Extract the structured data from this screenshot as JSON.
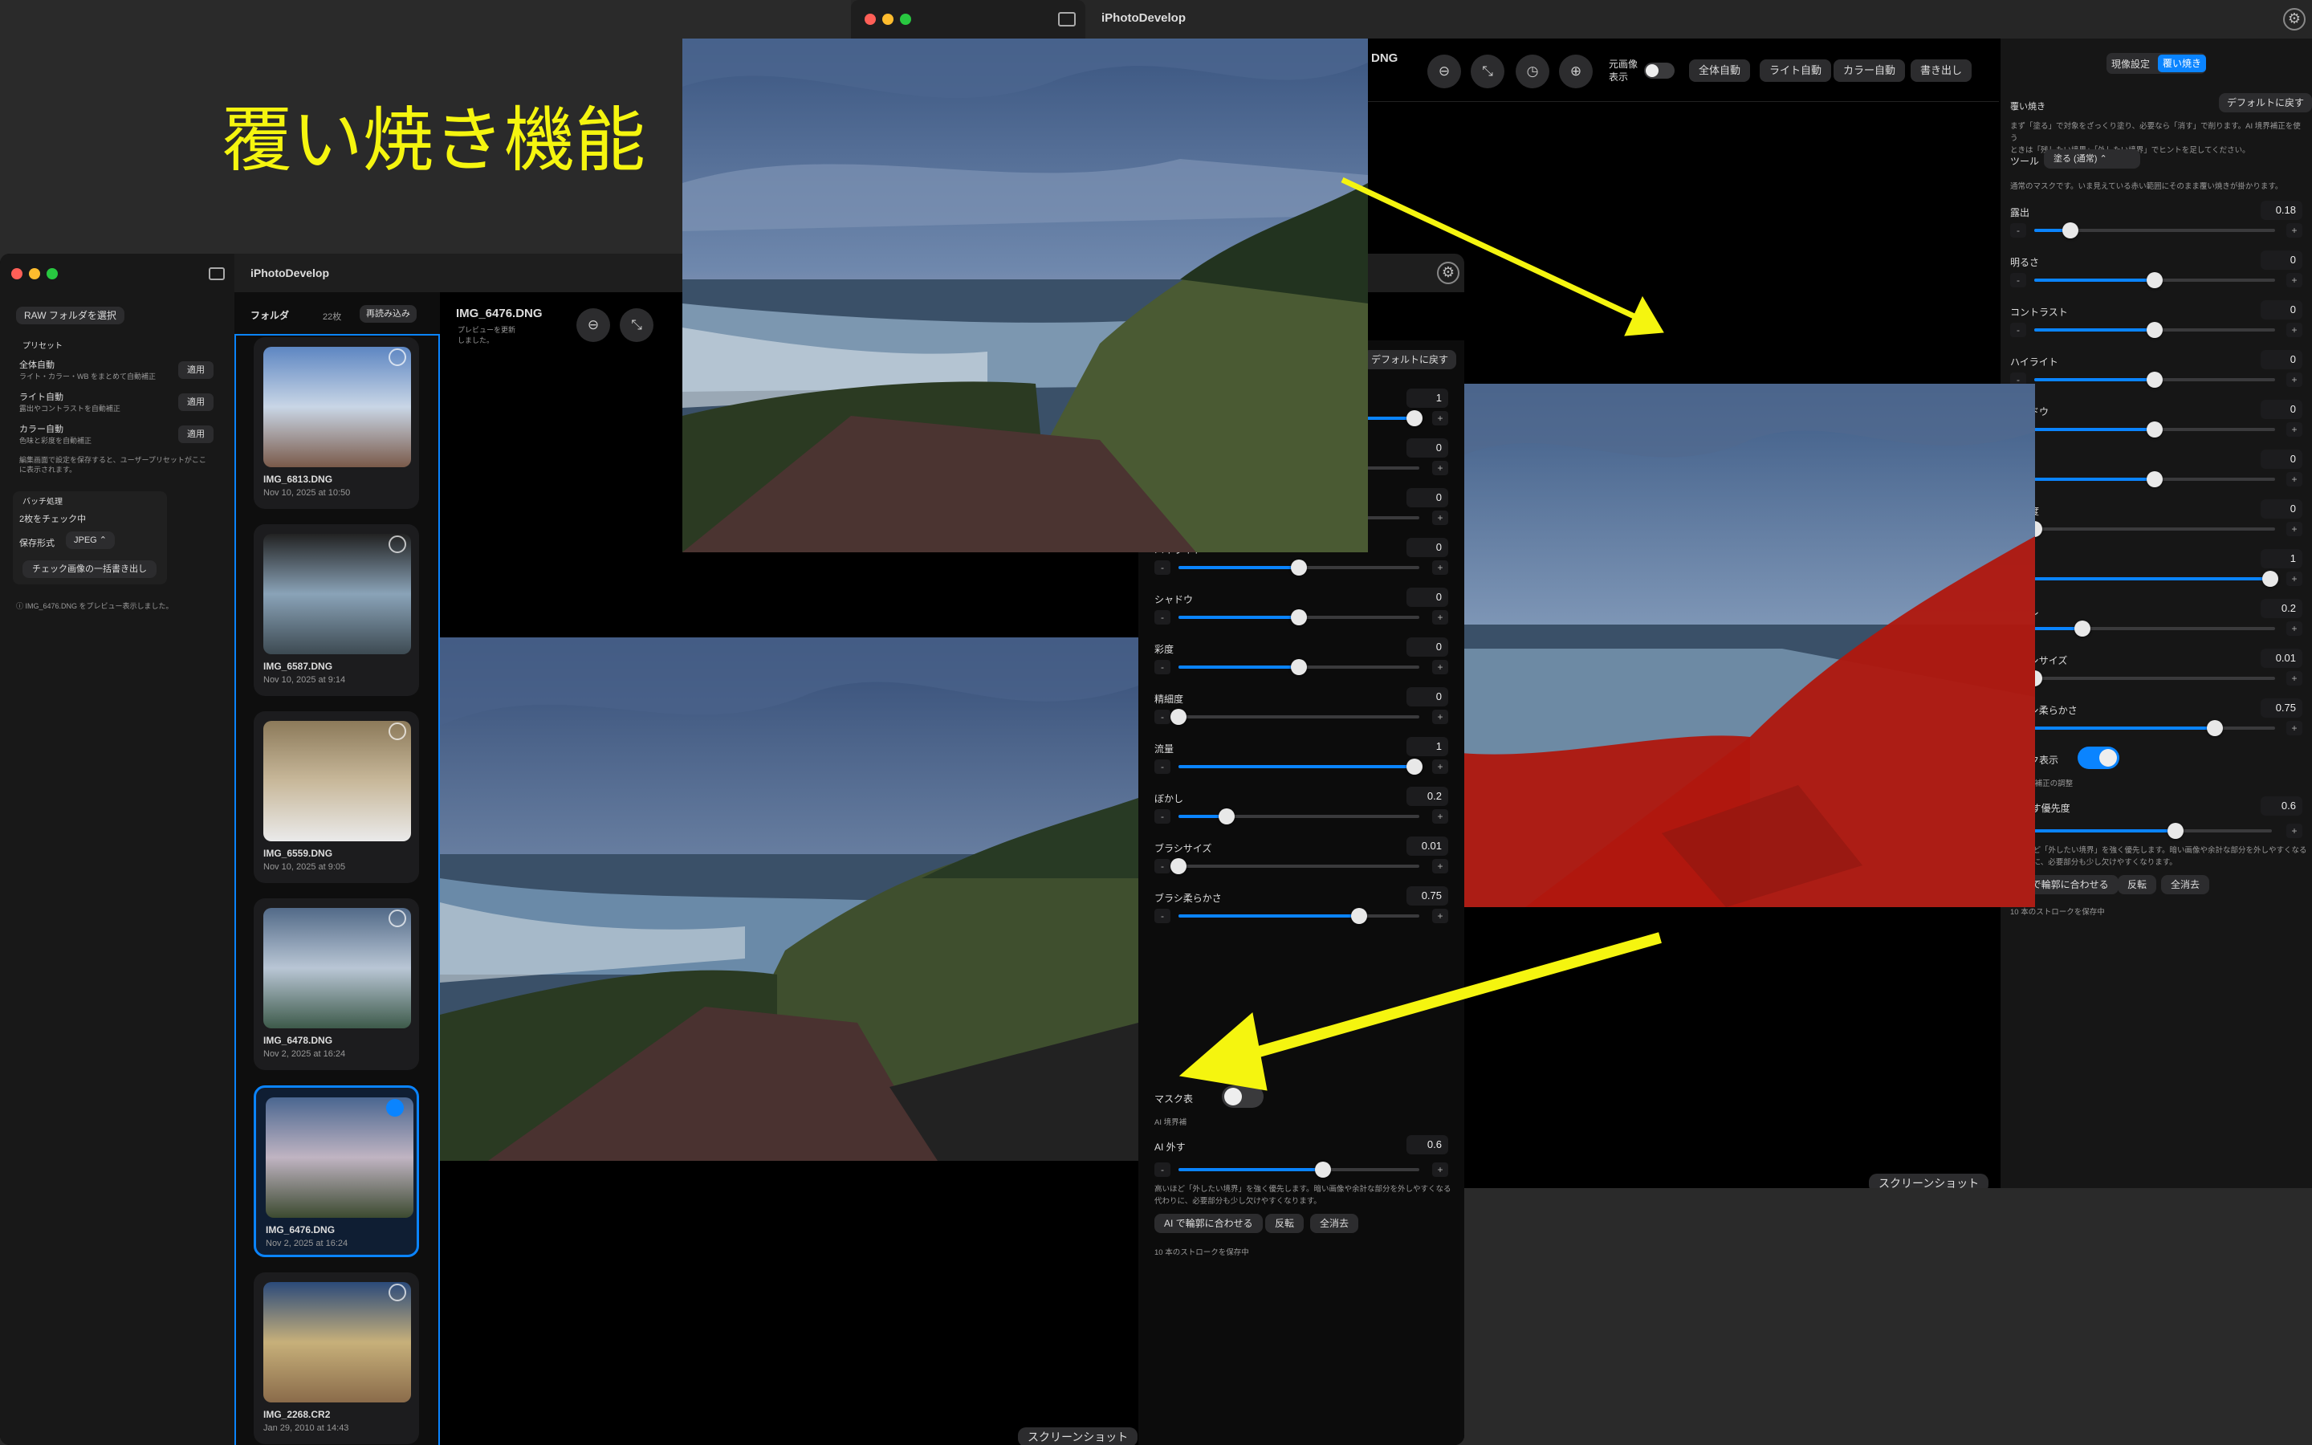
{
  "annotation_title": "覆い焼き機能",
  "app": {
    "name": "iPhotoDevelop"
  },
  "screenshot_tag": "スクリーンショット",
  "sidebar": {
    "choose_folder": "RAW フォルダを選択",
    "presets_heading": "プリセット",
    "presets": [
      {
        "title": "全体自動",
        "desc": "ライト・カラー・WB をまとめて自動補正",
        "button": "適用"
      },
      {
        "title": "ライト自動",
        "desc": "露出やコントラストを自動補正",
        "button": "適用"
      },
      {
        "title": "カラー自動",
        "desc": "色味と彩度を自動補正",
        "button": "適用"
      }
    ],
    "presets_note_1": "編集画面で設定を保存すると、ユーザープリセットがここ",
    "presets_note_2": "に表示されます。",
    "batch_heading": "バッチ処理",
    "batch_checked": "2枚をチェック中",
    "format_label": "保存形式",
    "format_value": "JPEG",
    "batch_export": "チェック画像の一括書き出し",
    "status": "IMG_6476.DNG をプレビュー表示しました。"
  },
  "browser": {
    "folder_label": "フォルダ",
    "count": "22枚",
    "reload": "再読み込み",
    "items": [
      {
        "name": "IMG_6813.DNG",
        "date": "Nov 10, 2025 at 10:50",
        "checked": false
      },
      {
        "name": "IMG_6587.DNG",
        "date": "Nov 10, 2025 at 9:14",
        "checked": false
      },
      {
        "name": "IMG_6559.DNG",
        "date": "Nov 10, 2025 at 9:05",
        "checked": false
      },
      {
        "name": "IMG_6478.DNG",
        "date": "Nov 2, 2025 at 16:24",
        "checked": false
      },
      {
        "name": "IMG_6476.DNG",
        "date": "Nov 2, 2025 at 16:24",
        "checked": true
      },
      {
        "name": "IMG_2268.CR2",
        "date": "Jan 29, 2010 at 14:43",
        "checked": false
      }
    ]
  },
  "viewer": {
    "filename": "IMG_6476.DNG",
    "filename_partial": "DNG",
    "preview_note_1": "プレビューを更新",
    "preview_note_2": "しました。",
    "original_label_1": "元画像",
    "original_label_2": "表示",
    "toolbar_buttons": [
      "全体自動",
      "ライト自動",
      "カラー自動",
      "書き出し"
    ]
  },
  "panel": {
    "tabs": [
      "現像設定",
      "覆い焼き"
    ],
    "section_title": "覆い焼き",
    "reset": "デフォルトに戻す",
    "intro_1": "まず「塗る」で対象をざっくり塗り、必要なら「消す」で削ります。AI 境界補正を使う",
    "intro_2": "ときは「残したい境界」「外したい境界」でヒントを足してください。",
    "tool_label": "ツール",
    "tool_value": "塗る (通常)",
    "tool_note": "通常のマスクです。いま見えている赤い範囲にそのまま覆い焼きが掛かります。",
    "sliders_right": [
      {
        "label": "露出",
        "value": "0.18",
        "pos": 0.15
      },
      {
        "label": "明るさ",
        "value": "0",
        "pos": 0.5
      },
      {
        "label": "コントラスト",
        "value": "0",
        "pos": 0.5
      },
      {
        "label": "ハイライト",
        "value": "0",
        "pos": 0.5
      },
      {
        "label": "シャドウ",
        "value": "0",
        "pos": 0.5
      },
      {
        "label": "彩度",
        "value": "0",
        "pos": 0.5
      },
      {
        "label": "精細度",
        "value": "0",
        "pos": 0.0
      },
      {
        "label": "流量",
        "value": "1",
        "pos": 0.98
      },
      {
        "label": "ぼかし",
        "value": "0.2",
        "pos": 0.2
      },
      {
        "label": "ブラシサイズ",
        "value": "0.01",
        "pos": 0.0
      },
      {
        "label": "ブラシ柔らかさ",
        "value": "0.75",
        "pos": 0.75
      }
    ],
    "sliders_mid": [
      {
        "label": "",
        "value": "1",
        "pos": 0.98
      },
      {
        "label": "",
        "value": "0",
        "pos": 0.5
      },
      {
        "label": "コントラスト",
        "value": "0",
        "pos": 0.5
      },
      {
        "label": "ハイライト",
        "value": "0",
        "pos": 0.5
      },
      {
        "label": "シャドウ",
        "value": "0",
        "pos": 0.5
      },
      {
        "label": "彩度",
        "value": "0",
        "pos": 0.5
      },
      {
        "label": "精細度",
        "value": "0",
        "pos": 0.0
      },
      {
        "label": "流量",
        "value": "1",
        "pos": 0.98
      },
      {
        "label": "ぼかし",
        "value": "0.2",
        "pos": 0.2
      },
      {
        "label": "ブラシサイズ",
        "value": "0.01",
        "pos": 0.0
      },
      {
        "label": "ブラシ柔らかさ",
        "value": "0.75",
        "pos": 0.75
      }
    ],
    "mask_label": "マスク表示",
    "mask_label_mid": "マスク表",
    "ai_note": "AI 境界補正の調整",
    "ai_note_mid": "AI 境界補",
    "ai_label": "AI 外す優先度",
    "ai_label_mid": "AI 外す",
    "ai_value": "0.6",
    "ai_pos": 0.6,
    "ai_desc_1": "高いほど「外したい境界」を強く優先します。暗い画像や余計な部分を外しやすくなる",
    "ai_desc_2": "代わりに、必要部分も少し欠けやすくなります。",
    "buttons": [
      "AI で輪郭に合わせる",
      "反転",
      "全消去"
    ],
    "footer": "10 本のストロークを保存中"
  },
  "colors": {
    "accent": "#0a84ff",
    "annotation": "#f5f50f",
    "mask": "#c0140f"
  }
}
